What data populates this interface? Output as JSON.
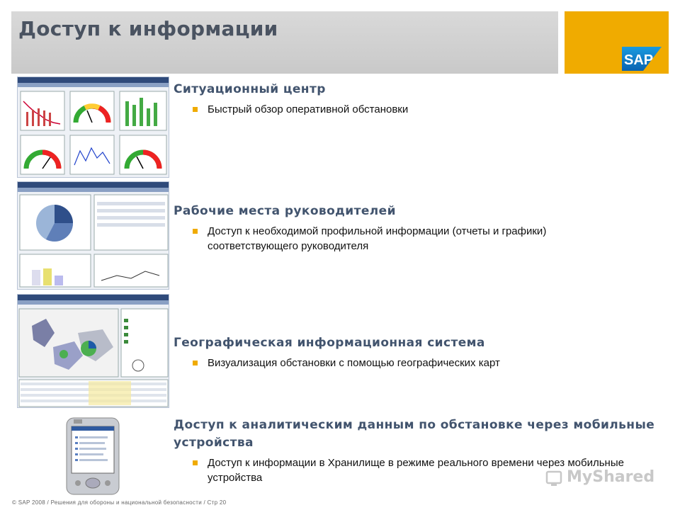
{
  "header": {
    "title": "Доступ к информации",
    "logo_text": "SAP",
    "accent_color": "#f0ab00"
  },
  "sections": [
    {
      "heading": "Ситуационный центр",
      "bullets": [
        "Быстрый обзор оперативной обстановки"
      ]
    },
    {
      "heading": "Рабочие места руководителей",
      "bullets": [
        "Доступ к необходимой профильной информации (отчеты и графики) соответствующего руководителя"
      ]
    },
    {
      "heading": "Географическая информационная система",
      "bullets": [
        "Визуализация обстановки с помощью географических карт"
      ]
    },
    {
      "heading": "Доступ к аналитическим данным по обстановке через мобильные устройства",
      "bullets": [
        "Доступ к информации в Хранилище в режиме реального времени через мобильные устройства"
      ]
    }
  ],
  "footer": {
    "text": "© SAP 2008 / Решения для обороны и национальной безопасности / Стр 20"
  },
  "watermark": {
    "text": "MyShared"
  },
  "icons": [
    "sap-logo",
    "bullet-square-icon",
    "mobile-device-icon",
    "watermark-icon"
  ]
}
